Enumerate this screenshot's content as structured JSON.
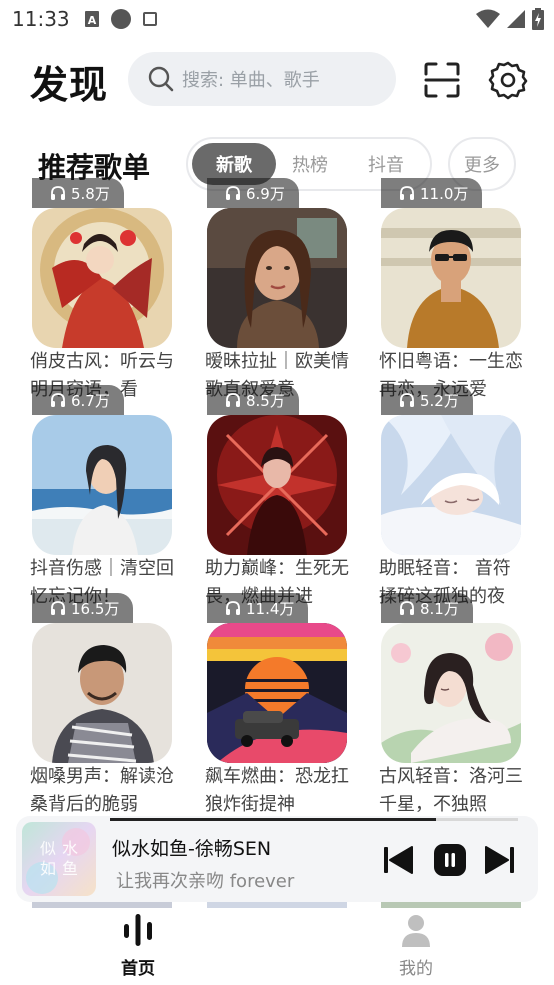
{
  "status_bar": {
    "time": "11:33",
    "left_icons": [
      "font-a-icon",
      "dot-icon",
      "square-icon"
    ],
    "right_icons": [
      "wifi-icon",
      "signal-icon",
      "battery-icon"
    ]
  },
  "header": {
    "title": "发现",
    "search_placeholder": "搜索: 单曲、歌手"
  },
  "section": {
    "title": "推荐歌单",
    "tabs": [
      {
        "label": "新歌",
        "active": true
      },
      {
        "label": "热榜",
        "active": false
      },
      {
        "label": "抖音",
        "active": false
      }
    ],
    "more_label": "更多"
  },
  "playlists": [
    {
      "plays": "5.8万",
      "title": "俏皮古风：听云与明月窃语，看"
    },
    {
      "plays": "6.9万",
      "title": "暧昧拉扯｜欧美情歌直叙爱意"
    },
    {
      "plays": "11.0万",
      "title": "怀旧粤语：一生恋再恋，永远爱"
    },
    {
      "plays": "6.7万",
      "title": "抖音伤感｜清空回忆忘记你！"
    },
    {
      "plays": "8.5万",
      "title": "助力巅峰：生死无畏，燃曲并进"
    },
    {
      "plays": "5.2万",
      "title": "助眠轻音： 音符揉碎这孤独的夜"
    },
    {
      "plays": "16.5万",
      "title": "烟嗓男声：解读沧桑背后的脆弱"
    },
    {
      "plays": "11.4万",
      "title": "飙车燃曲：恐龙扛狼炸街提神"
    },
    {
      "plays": "8.1万",
      "title": "古风轻音：洛河三千星，不独照"
    }
  ],
  "mini_player": {
    "song": "似水如鱼-徐畅SEN",
    "lyric": "让我再次亲吻 forever",
    "art_text": "似水如鱼",
    "progress": 0.8
  },
  "bottom_nav": {
    "home_label": "首页",
    "mine_label": "我的"
  },
  "colors": {
    "accent": "#6a6a6a",
    "search_bg": "#eef0f3",
    "player_bg": "#f4f5f7"
  }
}
